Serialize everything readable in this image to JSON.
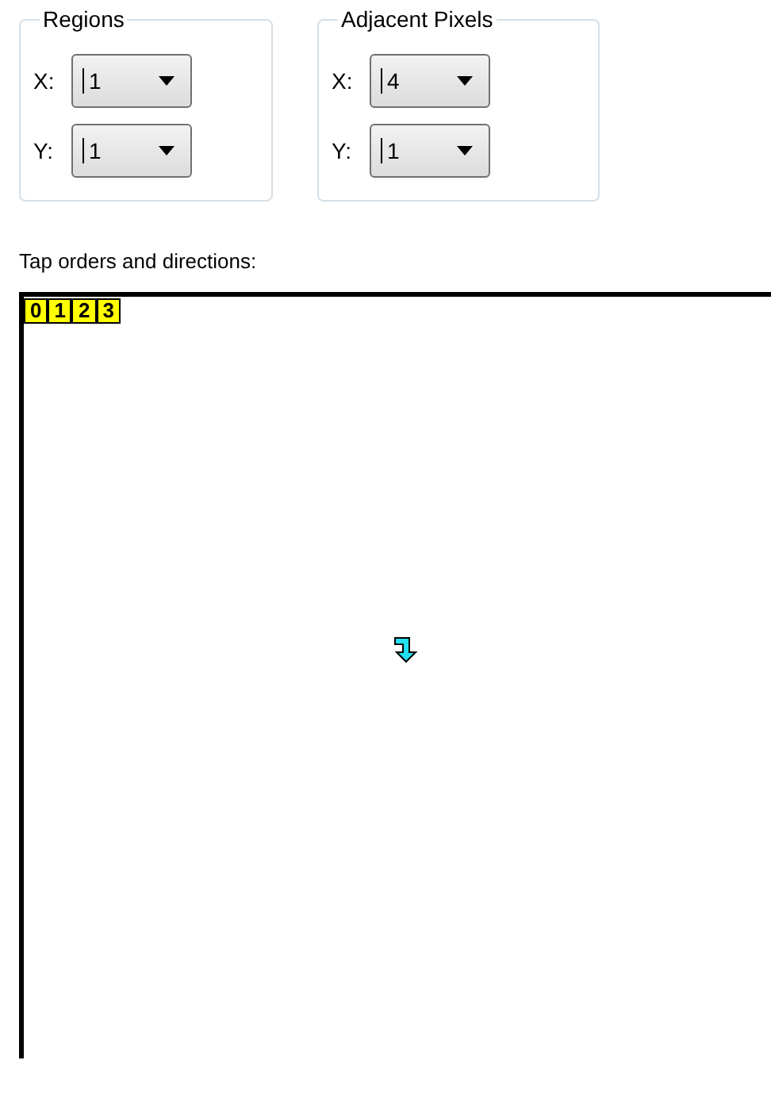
{
  "groups": [
    {
      "title": "Regions",
      "fields": [
        {
          "label": "X:",
          "value": "1"
        },
        {
          "label": "Y:",
          "value": "1"
        }
      ]
    },
    {
      "title": "Adjacent Pixels",
      "fields": [
        {
          "label": "X:",
          "value": "4"
        },
        {
          "label": "Y:",
          "value": "1"
        }
      ]
    }
  ],
  "canvas_label": "Tap orders and directions:",
  "order_tags": [
    "0",
    "1",
    "2",
    "3"
  ]
}
